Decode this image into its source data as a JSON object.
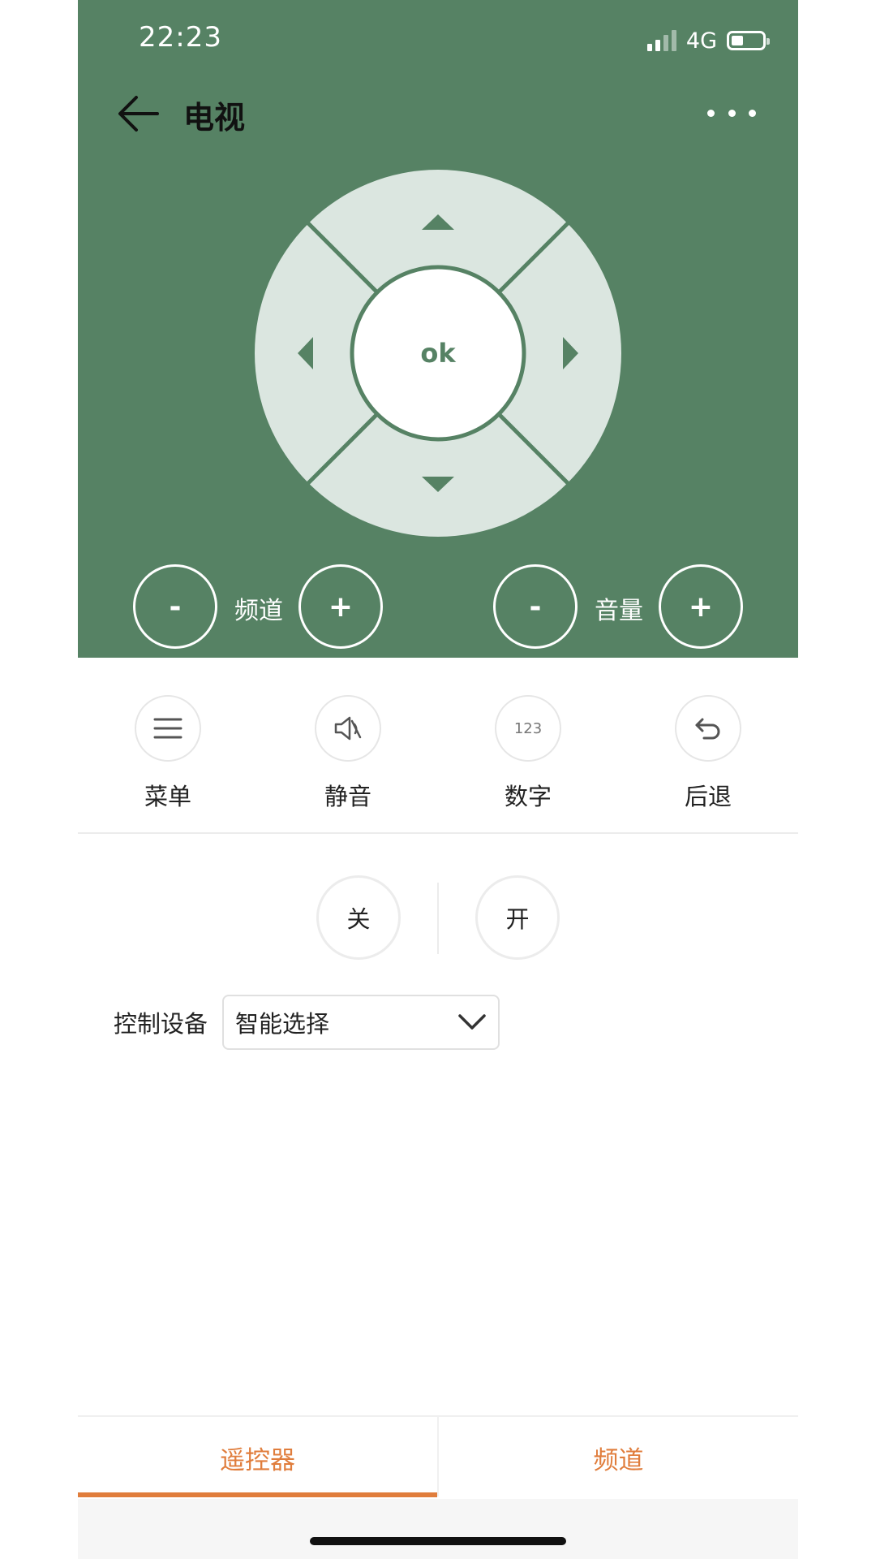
{
  "status_bar": {
    "time": "22:23",
    "network": "4G",
    "signal_level": 2,
    "signal_max": 4,
    "battery_level": 0.3
  },
  "header": {
    "title": "电视",
    "back_icon": "arrow-left-icon",
    "more_icon": "more-horizontal-icon",
    "background": "#568264"
  },
  "dpad": {
    "ok_label": "ok",
    "up_icon": "triangle-up-icon",
    "down_icon": "triangle-down-icon",
    "left_icon": "triangle-left-icon",
    "right_icon": "triangle-right-icon"
  },
  "channel": {
    "label": "频道",
    "minus": "-",
    "plus": "+"
  },
  "volume": {
    "label": "音量",
    "minus": "-",
    "plus": "+"
  },
  "functions": [
    {
      "label": "菜单",
      "icon": "menu-icon"
    },
    {
      "label": "静音",
      "icon": "mute-icon"
    },
    {
      "label": "数字",
      "icon": "numbers-icon",
      "glyph": "123"
    },
    {
      "label": "后退",
      "icon": "undo-icon"
    }
  ],
  "power": {
    "off_label": "关",
    "on_label": "开"
  },
  "device": {
    "label": "控制设备",
    "selected": "智能选择",
    "icon": "chevron-down-icon"
  },
  "tabs": [
    {
      "label": "遥控器",
      "active": true
    },
    {
      "label": "频道",
      "active": false
    }
  ],
  "colors": {
    "accent": "#e07d3c",
    "header_green": "#568264",
    "dpad_light": "#dbe6e0"
  }
}
